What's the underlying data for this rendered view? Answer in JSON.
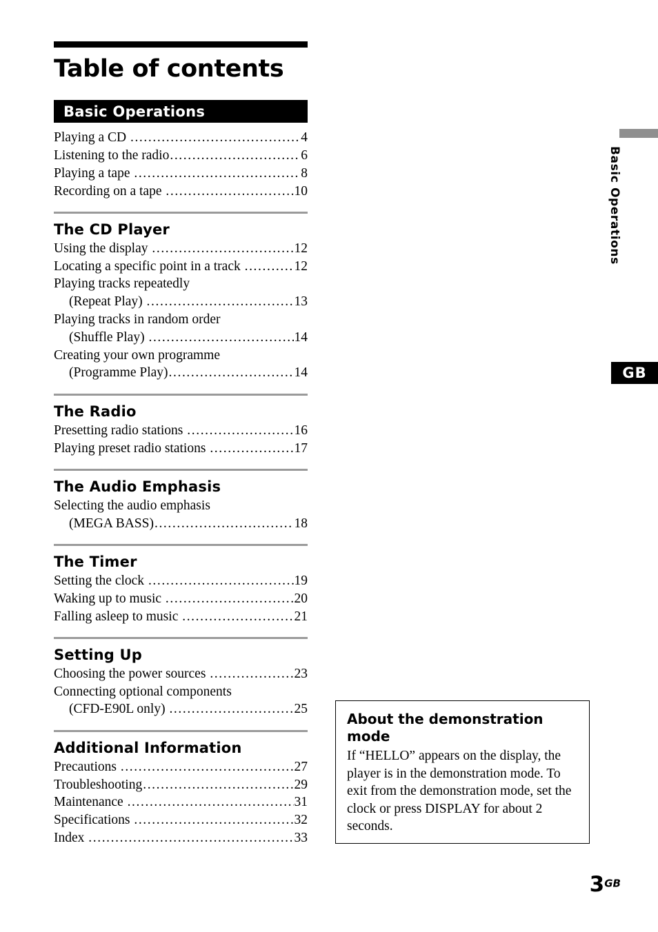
{
  "page": {
    "title": "Table of contents",
    "folio_number": "3",
    "folio_suffix": "GB"
  },
  "margin_tab": {
    "label": "Basic Operations",
    "language_tab": "GB",
    "bar_color": "#8f8f8f",
    "tab_color": "#000000"
  },
  "toc": {
    "banner": {
      "label": "Basic Operations",
      "background": "#000000",
      "text_color": "#ffffff"
    },
    "banner_entries": [
      {
        "label": "Playing a CD ",
        "page": "4"
      },
      {
        "label": "Listening to the radio",
        "page": "6"
      },
      {
        "label": "Playing a tape ",
        "page": "8"
      },
      {
        "label": "Recording on a tape ",
        "page": "10"
      }
    ],
    "sections": [
      {
        "heading": "The CD Player",
        "entries": [
          {
            "label": "Using the display ",
            "page": "12"
          },
          {
            "label": "Locating a specific point in a track ",
            "page": "12"
          },
          {
            "first_line": "Playing tracks repeatedly",
            "label": "(Repeat Play) ",
            "page": "13"
          },
          {
            "first_line": "Playing tracks in random order",
            "label": "(Shuffle Play) ",
            "page": "14"
          },
          {
            "first_line": "Creating your own programme",
            "label": "(Programme Play)",
            "page": "14"
          }
        ]
      },
      {
        "heading": "The Radio",
        "entries": [
          {
            "label": "Presetting radio stations ",
            "page": "16"
          },
          {
            "label": "Playing preset radio stations ",
            "page": "17"
          }
        ]
      },
      {
        "heading": "The Audio Emphasis",
        "entries": [
          {
            "first_line": "Selecting the audio emphasis",
            "label": "(MEGA BASS)",
            "page": "18"
          }
        ]
      },
      {
        "heading": "The Timer",
        "entries": [
          {
            "label": "Setting the clock ",
            "page": "19"
          },
          {
            "label": "Waking up to music ",
            "page": "20"
          },
          {
            "label": "Falling asleep to music ",
            "page": "21"
          }
        ]
      },
      {
        "heading": "Setting Up",
        "entries": [
          {
            "label": "Choosing the power sources ",
            "page": "23"
          },
          {
            "first_line": "Connecting optional components",
            "label": "(CFD-E90L only) ",
            "page": "25"
          }
        ]
      },
      {
        "heading": "Additional Information",
        "entries": [
          {
            "label": "Precautions ",
            "page": "27"
          },
          {
            "label": "Troubleshooting",
            "page": "29"
          },
          {
            "label": "Maintenance ",
            "page": "31"
          },
          {
            "label": "Specifications ",
            "page": "32"
          },
          {
            "label": "Index ",
            "page": "33"
          }
        ]
      }
    ]
  },
  "callout": {
    "title": "About the demonstration mode",
    "body": "If “HELLO” appears on the display, the player is in the demonstration mode. To exit from the demonstration mode, set the clock or press DISPLAY for about 2 seconds."
  }
}
